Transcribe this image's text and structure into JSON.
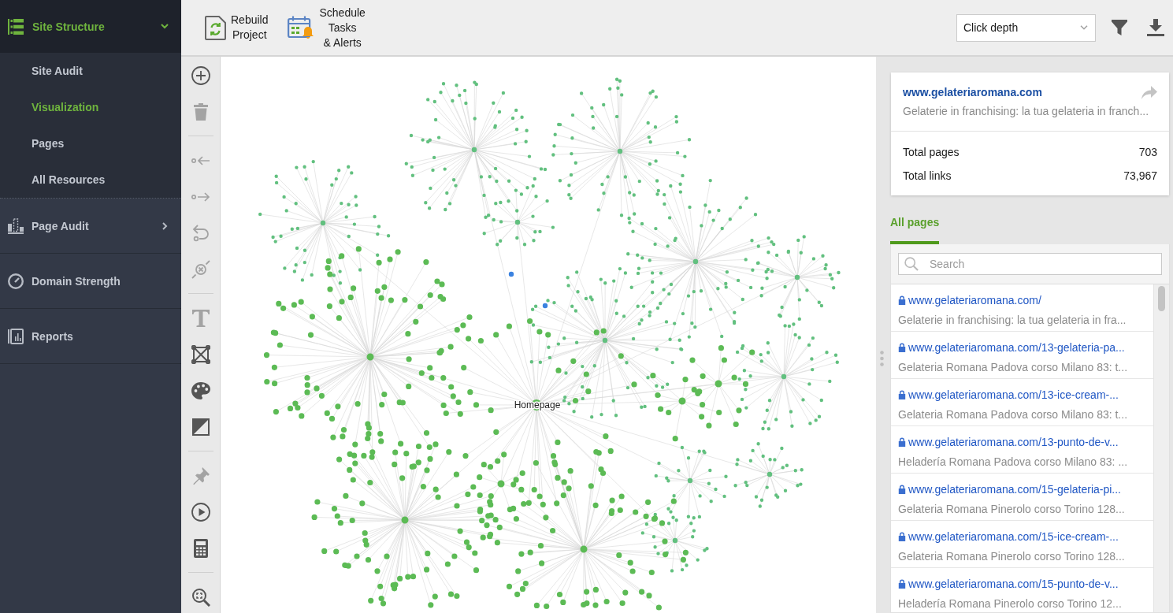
{
  "sidebar": {
    "sections": [
      {
        "label": "Site Structure",
        "kind": "group",
        "expanded": true,
        "selected": true,
        "children": [
          {
            "label": "Site Audit",
            "selected": false
          },
          {
            "label": "Visualization",
            "selected": true
          },
          {
            "label": "Pages",
            "selected": false
          },
          {
            "label": "All Resources",
            "selected": false
          }
        ]
      },
      {
        "label": "Page Audit",
        "kind": "group",
        "expanded": false,
        "selected": false
      },
      {
        "label": "Domain Strength",
        "kind": "link",
        "selected": false
      },
      {
        "label": "Reports",
        "kind": "link",
        "selected": false
      }
    ]
  },
  "toolbar": {
    "buttons": [
      {
        "kind": "rebuild",
        "lines": [
          "Rebuild",
          "Project"
        ]
      },
      {
        "kind": "schedule",
        "lines": [
          "Schedule",
          "Tasks",
          "& Alerts"
        ]
      }
    ],
    "view_select": {
      "value": "Click depth"
    }
  },
  "tool_strip": {
    "groups": [
      {
        "tools": [
          {
            "kind": "add",
            "disabled": false
          },
          {
            "kind": "delete",
            "disabled": true
          }
        ]
      },
      {
        "tools": [
          {
            "kind": "incoming",
            "disabled": true
          },
          {
            "kind": "outgoing",
            "disabled": true
          },
          {
            "kind": "loop",
            "disabled": true
          },
          {
            "kind": "detach",
            "disabled": true
          }
        ]
      },
      {
        "tools": [
          {
            "kind": "text",
            "disabled": true
          },
          {
            "kind": "frame",
            "disabled": false
          },
          {
            "kind": "palette",
            "disabled": false
          },
          {
            "kind": "contrast",
            "disabled": false
          }
        ]
      },
      {
        "tools": [
          {
            "kind": "pin",
            "disabled": true
          },
          {
            "kind": "play",
            "disabled": false
          },
          {
            "kind": "calculator",
            "disabled": false
          }
        ]
      },
      {
        "tools": [
          {
            "kind": "zoom",
            "disabled": false
          }
        ]
      }
    ]
  },
  "graph": {
    "center_label": "Homepage"
  },
  "site_card": {
    "title": "www.gelateriaromana.com",
    "description": "Gelaterie in franchising: la tua gelateria in franch...",
    "stats": [
      {
        "label": "Total pages",
        "value": "703"
      },
      {
        "label": "Total links",
        "value": "73,967"
      }
    ]
  },
  "tabs": [
    {
      "label": "All pages",
      "selected": true
    }
  ],
  "search": {
    "placeholder": "Search"
  },
  "pages": [
    {
      "url": "www.gelateriaromana.com/",
      "title": "Gelaterie in franchising: la tua gelateria in fra...",
      "secure": true
    },
    {
      "url": "www.gelateriaromana.com/13-gelateria-pa...",
      "title": "Gelateria Romana Padova corso Milano 83: t...",
      "secure": true
    },
    {
      "url": "www.gelateriaromana.com/13-ice-cream-...",
      "title": "Gelateria Romana Padova corso Milano 83: t...",
      "secure": true
    },
    {
      "url": "www.gelateriaromana.com/13-punto-de-v...",
      "title": "Heladería Romana Padova corso Milano 83: ...",
      "secure": true
    },
    {
      "url": "www.gelateriaromana.com/15-gelateria-pi...",
      "title": "Gelateria Romana Pinerolo corso Torino 128...",
      "secure": true
    },
    {
      "url": "www.gelateriaromana.com/15-ice-cream-...",
      "title": "Gelateria Romana Pinerolo corso Torino 128...",
      "secure": true
    },
    {
      "url": "www.gelateriaromana.com/15-punto-de-v...",
      "title": "Heladería Romana Pinerolo corso Torino 12...",
      "secure": true
    }
  ]
}
